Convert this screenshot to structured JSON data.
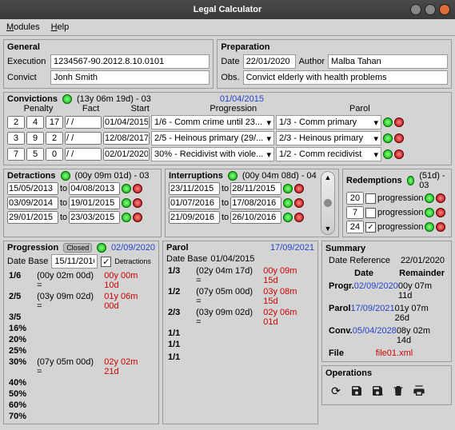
{
  "window": {
    "title": "Legal Calculator"
  },
  "menu": {
    "modules": "Modules",
    "help": "Help"
  },
  "general": {
    "title": "General",
    "exec_label": "Execution",
    "exec_val": "1234567-90.2012.8.10.0101",
    "convict_label": "Convict",
    "convict_val": "Jonh Smith"
  },
  "prep": {
    "title": "Preparation",
    "date_label": "Date",
    "date_val": "22/01/2020",
    "author_label": "Author",
    "author_val": "Malba Tahan",
    "obs_label": "Obs.",
    "obs_val": "Convict elderly with health problems"
  },
  "conv": {
    "title": "Convictions",
    "summary": "(13y 06m 19d) - 03",
    "date": "01/04/2015",
    "h": {
      "penalty": "Penalty",
      "fact": "Fact",
      "start": "Start",
      "progression": "Progression",
      "parol": "Parol"
    },
    "rows": [
      {
        "p1": "2",
        "p2": "4",
        "p3": "17",
        "fact": "/ /",
        "start": "01/04/2015",
        "prog": "1/6 - Comm crime until 23...",
        "parol": "1/3 - Comm primary"
      },
      {
        "p1": "3",
        "p2": "9",
        "p3": "2",
        "fact": "/ /",
        "start": "12/08/2017",
        "prog": "2/5 - Heinous primary (29/...",
        "parol": "2/3 - Heinous primary"
      },
      {
        "p1": "7",
        "p2": "5",
        "p3": "0",
        "fact": "/ /",
        "start": "02/01/2020",
        "prog": "30% - Recidivist with viole...",
        "parol": "1/2 - Comm recidivist"
      }
    ]
  },
  "detr": {
    "title": "Detractions",
    "summary": "(00y 09m 01d) - 03",
    "rows": [
      {
        "from": "15/05/2013",
        "to_l": "to",
        "to": "04/08/2013"
      },
      {
        "from": "03/09/2014",
        "to_l": "to",
        "to": "19/01/2015"
      },
      {
        "from": "29/01/2015",
        "to_l": "to",
        "to": "23/03/2015"
      }
    ]
  },
  "intr": {
    "title": "Interruptions",
    "summary": "(00y 04m 08d) - 04",
    "rows": [
      {
        "from": "23/11/2015",
        "to_l": "to",
        "to": "28/11/2015"
      },
      {
        "from": "01/07/2016",
        "to_l": "to",
        "to": "17/08/2016"
      },
      {
        "from": "21/09/2016",
        "to_l": "to",
        "to": "26/10/2016"
      }
    ]
  },
  "redm": {
    "title": "Redemptions",
    "summary": "(51d) - 03",
    "rows": [
      {
        "n": "20",
        "chk": "",
        "label": "progression"
      },
      {
        "n": "7",
        "chk": "",
        "label": "progression"
      },
      {
        "n": "24",
        "chk": "✓",
        "label": "progression"
      }
    ]
  },
  "prog": {
    "title": "Progression",
    "closed": "Closed",
    "date": "02/09/2020",
    "db_label": "Date Base",
    "db_val": "15/11/2016",
    "detr_label": "Detractions",
    "detr_chk": "✓",
    "rows": [
      {
        "f": "1/6",
        "d": "(00y 02m 00d) =",
        "r": "00y 00m 10d"
      },
      {
        "f": "2/5",
        "d": "(03y 09m 02d) =",
        "r": "01y 06m 00d"
      },
      {
        "f": "3/5",
        "d": "",
        "r": ""
      },
      {
        "f": "16%",
        "d": "",
        "r": ""
      },
      {
        "f": "20%",
        "d": "",
        "r": ""
      },
      {
        "f": "25%",
        "d": "",
        "r": ""
      },
      {
        "f": "30%",
        "d": "(07y 05m 00d) =",
        "r": "02y 02m 21d"
      },
      {
        "f": "40%",
        "d": "",
        "r": ""
      },
      {
        "f": "50%",
        "d": "",
        "r": ""
      },
      {
        "f": "60%",
        "d": "",
        "r": ""
      },
      {
        "f": "70%",
        "d": "",
        "r": ""
      }
    ]
  },
  "parol": {
    "title": "Parol",
    "date": "17/09/2021",
    "db_label": "Date Base",
    "db_val": "01/04/2015",
    "rows": [
      {
        "f": "1/3",
        "d": "(02y 04m 17d) =",
        "r": "00y 09m 15d"
      },
      {
        "f": "1/2",
        "d": "(07y 05m 00d) =",
        "r": "03y 08m 15d"
      },
      {
        "f": "2/3",
        "d": "(03y 09m 02d) =",
        "r": "02y 06m 01d"
      },
      {
        "f": "1/1",
        "d": "",
        "r": ""
      },
      {
        "f": "1/1",
        "d": "",
        "r": ""
      },
      {
        "f": "",
        "d": "",
        "r": ""
      },
      {
        "f": "1/1",
        "d": "",
        "r": ""
      }
    ]
  },
  "summary": {
    "title": "Summary",
    "ref_label": "Date Reference",
    "ref_val": "22/01/2020",
    "h_date": "Date",
    "h_rem": "Remainder",
    "rows": [
      {
        "l": "Progr.",
        "d": "02/09/2020",
        "r": "00y 07m 11d"
      },
      {
        "l": "Parol",
        "d": "17/09/2021",
        "r": "01y 07m 26d"
      },
      {
        "l": "Conv.",
        "d": "05/04/2028",
        "r": "08y 02m 14d"
      }
    ],
    "file_l": "File",
    "file_v": "file01.xml"
  },
  "ops": {
    "title": "Operations"
  }
}
